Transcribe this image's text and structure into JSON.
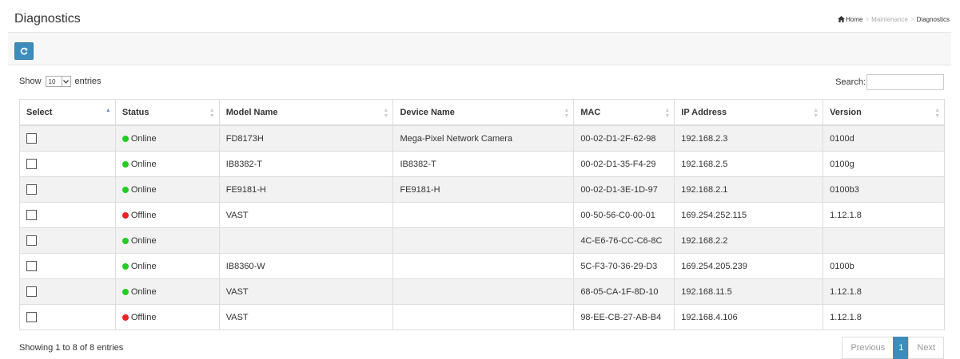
{
  "page": {
    "title": "Diagnostics",
    "breadcrumb": [
      "Home",
      "Maintenance",
      "Diagnostics"
    ]
  },
  "toolbar": {
    "refresh_icon": "refresh-icon"
  },
  "table_controls": {
    "show_label": "Show",
    "entries_label": "entries",
    "page_length": "10",
    "search_label": "Search:",
    "search_value": ""
  },
  "table": {
    "columns": [
      "Select",
      "Status",
      "Model Name",
      "Device Name",
      "MAC",
      "IP Address",
      "Version"
    ],
    "status_colors": {
      "Online": "#22cc22",
      "Offline": "#ee2222"
    },
    "rows": [
      {
        "status": "Online",
        "model": "FD8173H",
        "device": "Mega-Pixel Network Camera",
        "mac": "00-02-D1-2F-62-98",
        "ip": "192.168.2.3",
        "version": "0100d"
      },
      {
        "status": "Online",
        "model": "IB8382-T",
        "device": "IB8382-T",
        "mac": "00-02-D1-35-F4-29",
        "ip": "192.168.2.5",
        "version": "0100g"
      },
      {
        "status": "Online",
        "model": "FE9181-H",
        "device": "FE9181-H",
        "mac": "00-02-D1-3E-1D-97",
        "ip": "192.168.2.1",
        "version": "0100b3"
      },
      {
        "status": "Offline",
        "model": "VAST",
        "device": "",
        "mac": "00-50-56-C0-00-01",
        "ip": "169.254.252.115",
        "version": "1.12.1.8"
      },
      {
        "status": "Online",
        "model": "",
        "device": "",
        "mac": "4C-E6-76-CC-C6-8C",
        "ip": "192.168.2.2",
        "version": ""
      },
      {
        "status": "Online",
        "model": "IB8360-W",
        "device": "",
        "mac": "5C-F3-70-36-29-D3",
        "ip": "169.254.205.239",
        "version": "0100b"
      },
      {
        "status": "Online",
        "model": "VAST",
        "device": "",
        "mac": "68-05-CA-1F-8D-10",
        "ip": "192.168.11.5",
        "version": "1.12.1.8"
      },
      {
        "status": "Offline",
        "model": "VAST",
        "device": "",
        "mac": "98-EE-CB-27-AB-B4",
        "ip": "192.168.4.106",
        "version": "1.12.1.8"
      }
    ]
  },
  "footer": {
    "info": "Showing 1 to 8 of 8 entries",
    "pagination": {
      "previous": "Previous",
      "current_page": "1",
      "next": "Next"
    }
  }
}
